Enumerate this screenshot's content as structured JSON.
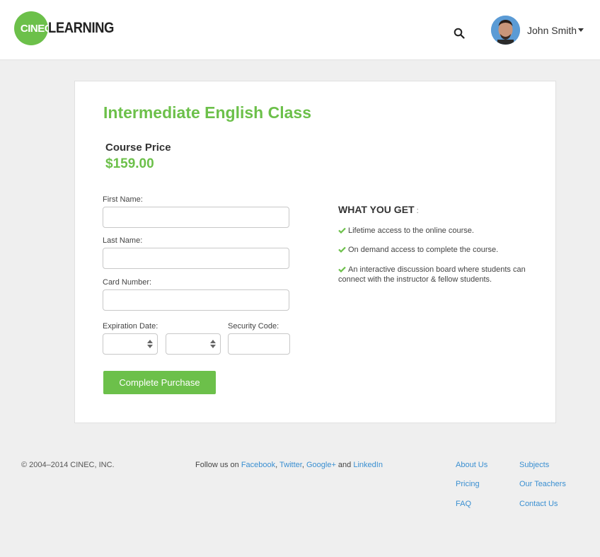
{
  "header": {
    "logo_mark": "CINEC",
    "logo_word": "LEARNING",
    "user_name": "John Smith"
  },
  "course": {
    "title": "Intermediate English Class",
    "price_label": "Course Price",
    "price_value": "$159.00"
  },
  "form": {
    "first_name_label": "First Name:",
    "first_name_value": "",
    "last_name_label": "Last Name:",
    "last_name_value": "",
    "card_number_label": "Card Number:",
    "card_number_value": "",
    "expiration_label": "Expiration Date:",
    "expiration_month": "",
    "expiration_year": "",
    "security_label": "Security Code:",
    "security_value": "",
    "submit_label": "Complete Purchase"
  },
  "benefits": {
    "title": "WHAT YOU GET",
    "colon": ":",
    "items": [
      "Lifetime access to the online course.",
      "On demand access to complete the course.",
      "An interactive discussion board where students can connect with the instructor & fellow students."
    ]
  },
  "footer": {
    "copyright": "© 2004–2014 CINEC, INC.",
    "follow_prefix": "Follow us on ",
    "social": [
      "Facebook",
      "Twitter",
      "Google+",
      "LinkedIn"
    ],
    "sep1": ", ",
    "sep2": ", ",
    "sep3": " and ",
    "links": [
      "About Us",
      "Subjects",
      "Pricing",
      "Our Teachers",
      "FAQ",
      "Contact Us"
    ]
  },
  "colors": {
    "accent": "#6cc04a",
    "link": "#3a8fd1",
    "background": "#efefef"
  },
  "icons": [
    "search-icon",
    "avatar",
    "chevron-down-icon",
    "check-icon",
    "select-arrows-icon"
  ]
}
